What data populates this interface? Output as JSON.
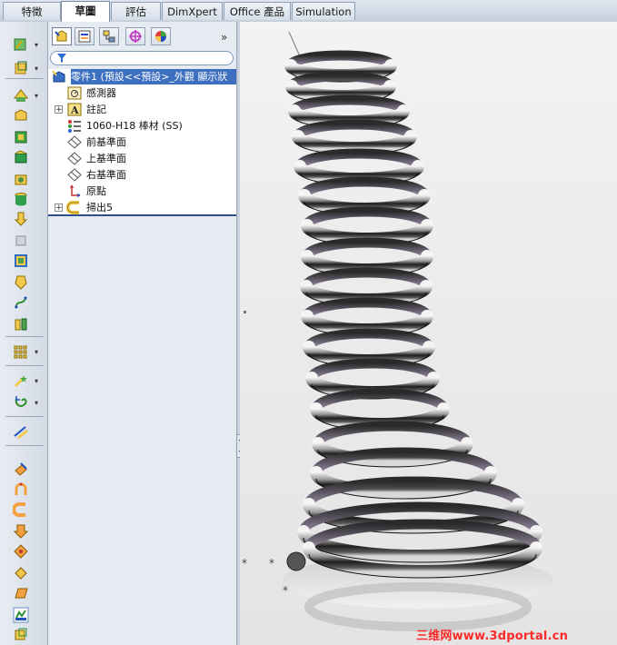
{
  "tabs": [
    {
      "label": "特徵",
      "active": false
    },
    {
      "label": "草圖",
      "active": true
    },
    {
      "label": "評估",
      "active": false
    },
    {
      "label": "DimXpert",
      "active": false
    },
    {
      "label": "Office 產品",
      "active": false
    },
    {
      "label": "Simulation",
      "active": false
    }
  ],
  "feature_tree": {
    "root": "零件1 (預設<<預設>_外觀 顯示狀",
    "items": [
      {
        "label": "感測器",
        "icon": "sensor-icon",
        "expandable": false
      },
      {
        "label": "註記",
        "icon": "annotation-icon",
        "expandable": true
      },
      {
        "label": "1060-H18 棒材 (SS)",
        "icon": "material-icon",
        "expandable": false
      },
      {
        "label": "前基準面",
        "icon": "plane-icon",
        "expandable": false
      },
      {
        "label": "上基準面",
        "icon": "plane-icon",
        "expandable": false
      },
      {
        "label": "右基準面",
        "icon": "plane-icon",
        "expandable": false
      },
      {
        "label": "原點",
        "icon": "origin-icon",
        "expandable": false
      },
      {
        "label": "掃出5",
        "icon": "sweep-icon",
        "expandable": true
      }
    ]
  },
  "panel_tabs": [
    "feature-manager-icon",
    "property-manager-icon",
    "configuration-manager-icon",
    "dimxpert-manager-icon",
    "display-manager-icon"
  ],
  "expand_glyph": "»",
  "watermark": "三维网www.3dportal.cn",
  "colors": {
    "selection": "#3d6fc1",
    "watermark": "#ff2a2a",
    "spring_metal": "#3a3a3a"
  }
}
